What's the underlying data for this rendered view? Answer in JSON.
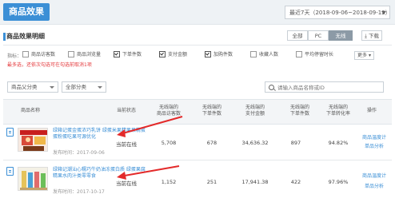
{
  "header": {
    "title": "商品效果",
    "date_range": "最近7天（2018-09-06~2018-09-12）"
  },
  "section": {
    "title": "商品效果明细",
    "segments": [
      "全部",
      "PC",
      "无线"
    ],
    "active_segment": "无线",
    "download_label": "下载"
  },
  "metrics": {
    "label": "指标：",
    "options": [
      {
        "label": "商品访客数",
        "checked": false
      },
      {
        "label": "商品浏览量",
        "checked": false
      },
      {
        "label": "下单件数",
        "checked": true
      },
      {
        "label": "支付金额",
        "checked": true
      },
      {
        "label": "加购件数",
        "checked": true
      },
      {
        "label": "收藏人数",
        "checked": false
      },
      {
        "label": "平均停留时长",
        "checked": false
      }
    ],
    "more_label": "更多",
    "warning": "最多选，还依次勾选可在勾选前取消1项"
  },
  "filters": {
    "category_select": "商品父分类",
    "sub_select": "全部分类",
    "search_placeholder": "请输入商品名称或ID"
  },
  "table": {
    "headers": {
      "name": "商品名称",
      "status": "当前状态",
      "col1_line1": "无线端的",
      "col1_line2": "商品访客数",
      "col2_line1": "无线端的",
      "col2_line2": "下单件数",
      "col3_line1": "无线端的",
      "col3_line2": "支付金额",
      "col4_line1": "无线端的",
      "col4_line2": "下单件数",
      "col5_line1": "无线端的",
      "col5_line2": "下单转化率",
      "ops": "操作"
    },
    "rows": [
      {
        "title": "绿箱记蛋金蛋浓巧乳饼 绿蛋米果精果果精蛋蛋粉蛋吃果可源优化",
        "publish": "发布时间：2017-09-06",
        "status": "当前在线",
        "col1": "5,708",
        "col2": "678",
        "col3": "34,636.32",
        "col4": "897",
        "col5": "94.82%",
        "op1": "商品温度计",
        "op2": "单品分析"
      },
      {
        "title": "绿箱记潮汕心糯巧牛奶油冻蛋白质 绿蛋果腐精果水肉汁类零零食",
        "publish": "发布时间：2017-10-17",
        "status": "当前在线",
        "col1": "1,152",
        "col2": "251",
        "col3": "17,941.38",
        "col4": "422",
        "col5": "97.96%",
        "op1": "商品温度计",
        "op2": "单品分析"
      }
    ]
  },
  "colors": {
    "accent": "#3b8fd6",
    "arrow": "#e32a2a",
    "warning": "#e4393c"
  }
}
